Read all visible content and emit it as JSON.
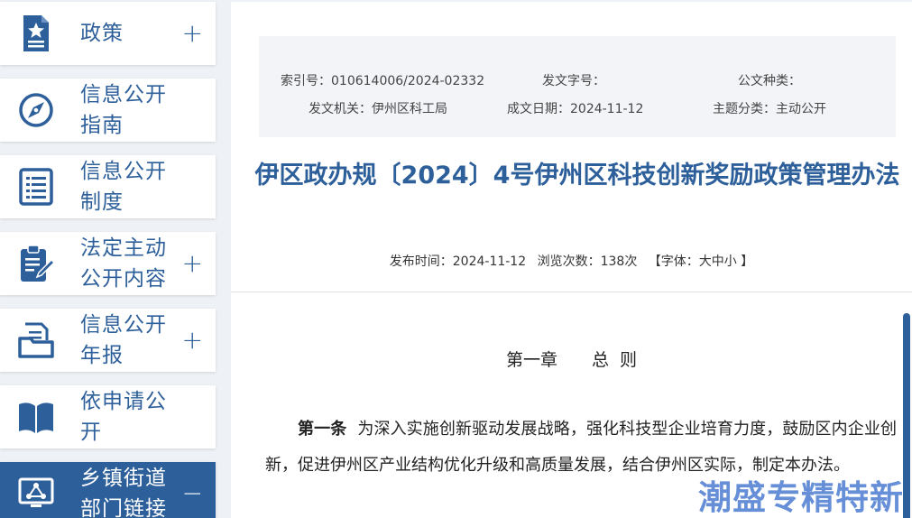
{
  "sidebar": {
    "items": [
      {
        "label": "政策",
        "toggle": "+",
        "icon": "star-document-icon"
      },
      {
        "label": "信息公开\n指南",
        "toggle": "",
        "icon": "compass-icon"
      },
      {
        "label": "信息公开\n制度",
        "toggle": "",
        "icon": "list-document-icon"
      },
      {
        "label": "法定主动\n公开内容",
        "toggle": "+",
        "icon": "clipboard-edit-icon"
      },
      {
        "label": "信息公开\n年报",
        "toggle": "+",
        "icon": "folder-document-icon"
      },
      {
        "label": "依申请公\n开",
        "toggle": "",
        "icon": "open-book-icon"
      },
      {
        "label": "乡镇街道\n部门链接",
        "toggle": "−",
        "icon": "network-monitor-icon"
      }
    ]
  },
  "info": {
    "index_no": "索引号：010614006/2024-02332",
    "doc_no": "发文字号：",
    "doc_type": "公文种类：",
    "issuer": "发文机关：伊州区科工局",
    "date": "成文日期：2024-11-12",
    "category": "主题分类：主动公开"
  },
  "document": {
    "title": "伊区政办规〔2024〕4号伊州区科技创新奖励政策管理办法",
    "publish_time": "发布时间：2024-11-12",
    "views": "浏览次数：138次",
    "font_size": "【字体：大中小 】",
    "chapter": "第一章　　总  则",
    "article_label": "第一条",
    "article_text": "为深入实施创新驱动发展战略，强化科技型企业培育力度，鼓励区内企业创新，促进伊州区产业结构优化升级和高质量发展，结合伊州区实际，制定本办法。"
  },
  "watermark": "潮盛专精特新",
  "colors": {
    "accent": "#2d5f9a",
    "background": "#eef1f5",
    "info_box": "#f2f4f8",
    "watermark": "#5a86d4"
  }
}
